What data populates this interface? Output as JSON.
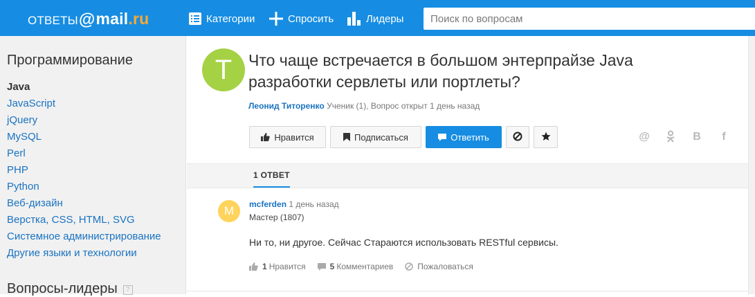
{
  "header": {
    "logo": {
      "part1": "ОТВЕТЫ",
      "at": "@",
      "part2": "mail",
      "dot": ".",
      "part3": "ru"
    },
    "nav": [
      {
        "label": "Категории",
        "icon": "list-icon"
      },
      {
        "label": "Спросить",
        "icon": "plus-icon"
      },
      {
        "label": "Лидеры",
        "icon": "bar-chart-icon"
      }
    ],
    "search_placeholder": "Поиск по вопросам"
  },
  "sidebar": {
    "title": "Программирование",
    "items": [
      {
        "label": "Java",
        "active": true
      },
      {
        "label": "JavaScript"
      },
      {
        "label": "jQuery"
      },
      {
        "label": "MySQL"
      },
      {
        "label": "Perl"
      },
      {
        "label": "PHP"
      },
      {
        "label": "Python"
      },
      {
        "label": "Веб-дизайн"
      },
      {
        "label": "Верстка, CSS, HTML, SVG"
      },
      {
        "label": "Системное администрирование"
      },
      {
        "label": "Другие языки и технологии"
      }
    ],
    "leaders_title": "Вопросы-лидеры",
    "help": "?"
  },
  "question": {
    "avatar_letter": "Т",
    "title": "Что чаще встречается в большом энтерпрайзе Java разработки сервлеты или портлеты?",
    "author": "Леонид Титоренко",
    "meta": "Ученик (1), Вопрос открыт 1 день назад",
    "buttons": {
      "like": "Нравится",
      "subscribe": "Подписаться",
      "answer": "Ответить"
    },
    "share": [
      "@",
      "ok",
      "В",
      "f"
    ]
  },
  "answers": {
    "tab_label": "1 ОТВЕТ",
    "items": [
      {
        "avatar_letter": "M",
        "author": "mcferden",
        "time": "1 день назад",
        "rank": "Мастер (1807)",
        "text": "Ни то, ни другое. Сейчас Стараются использовать RESTful сервисы.",
        "likes_count": "1",
        "likes_label": "Нравится",
        "comments_count": "5",
        "comments_label": "Комментариев",
        "report_label": "Пожаловаться"
      }
    ]
  },
  "colors": {
    "header": "#168de2",
    "accent_orange": "#ffa930",
    "link": "#1a73c1",
    "avatar_q": "#a5d145",
    "avatar_a": "#ffd35c"
  }
}
